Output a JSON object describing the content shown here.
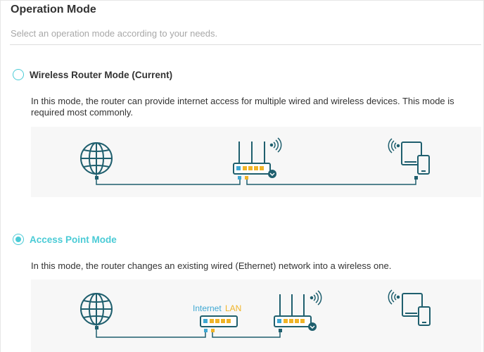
{
  "page": {
    "title": "Operation Mode",
    "subtitle": "Select an operation mode according to your needs."
  },
  "modes": [
    {
      "label": "Wireless Router Mode (Current)",
      "selected": false,
      "description": "In this mode, the router can provide internet access for multiple wired and wireless devices. This mode is required most commonly."
    },
    {
      "label": "Access Point Mode",
      "selected": true,
      "description": "In this mode, the router changes an existing wired (Ethernet) network into a wireless one."
    }
  ],
  "ap_diagram": {
    "internet_port_label": "Internet",
    "lan_port_label": "LAN"
  },
  "colors": {
    "accent": "#4acbd6",
    "line": "#1f5f6e",
    "port_blue": "#3fa8d3",
    "port_yellow": "#f0b428",
    "diagram_bg": "#f7f7f7"
  },
  "icons": [
    "globe-icon",
    "router-icon",
    "wifi-signal-icon",
    "devices-icon",
    "switch-icon"
  ]
}
